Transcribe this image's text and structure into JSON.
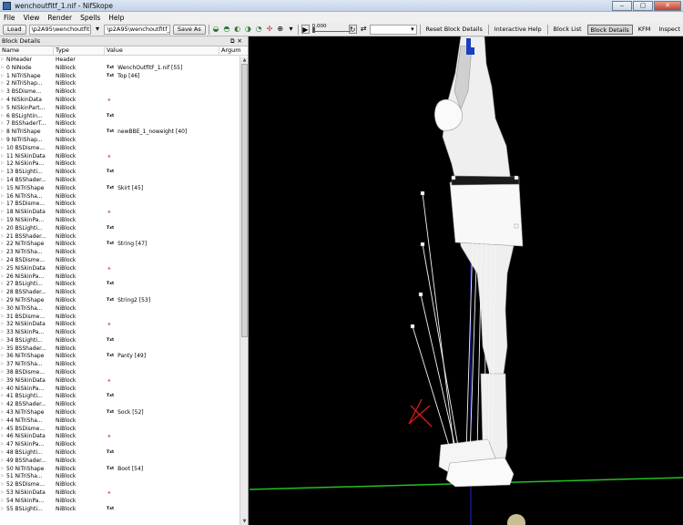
{
  "window": {
    "title": "wenchoutfitf_1.nif - NifSkope",
    "min": "‒",
    "max": "▢",
    "close": "✕"
  },
  "menu": [
    "File",
    "View",
    "Render",
    "Spells",
    "Help"
  ],
  "toolbar": {
    "load": "Load",
    "path_load": "\\p2A95\\wenchoutfitf_1.nif",
    "path_save": "\\p2A95\\wenchoutfitf_1.nif",
    "save_as": "Save As",
    "slider_value": "0.000",
    "reset": "Reset Block Details",
    "help": "Interactive Help",
    "block_list": "Block List",
    "block_details": "Block Details",
    "kfm": "KFM",
    "inspect": "Inspect"
  },
  "panel": {
    "title": "Block Details",
    "columns": [
      "Name",
      "Type",
      "Value",
      "Argum"
    ],
    "rows": [
      {
        "name": "NiHeader",
        "type": "Header",
        "value": "",
        "badge": ""
      },
      {
        "name": "0 NiNode",
        "type": "NiBlock",
        "value": "WenchOutfitF_1.nif [55]",
        "badge": "Txt"
      },
      {
        "name": "1 NiTriShape",
        "type": "NiBlock",
        "value": "Top [46]",
        "badge": "Txt"
      },
      {
        "name": "2 NiTriShap...",
        "type": "NiBlock",
        "value": "",
        "badge": ""
      },
      {
        "name": "3 BSDisme...",
        "type": "NiBlock",
        "value": "",
        "badge": ""
      },
      {
        "name": "4 NiSkinData",
        "type": "NiBlock",
        "value": "",
        "badge": "skin"
      },
      {
        "name": "5 NiSkinPart...",
        "type": "NiBlock",
        "value": "",
        "badge": ""
      },
      {
        "name": "6 BSLightin...",
        "type": "NiBlock",
        "value": "",
        "badge": "Txt"
      },
      {
        "name": "7 BSShaderT...",
        "type": "NiBlock",
        "value": "",
        "badge": ""
      },
      {
        "name": "8 NiTriShape",
        "type": "NiBlock",
        "value": "newBBE_1_noweight [40]",
        "badge": "Txt"
      },
      {
        "name": "9 NiTriShap...",
        "type": "NiBlock",
        "value": "",
        "badge": ""
      },
      {
        "name": "10 BSDisme...",
        "type": "NiBlock",
        "value": "",
        "badge": ""
      },
      {
        "name": "11 NiSkinData",
        "type": "NiBlock",
        "value": "",
        "badge": "skin"
      },
      {
        "name": "12 NiSkinPa...",
        "type": "NiBlock",
        "value": "",
        "badge": ""
      },
      {
        "name": "13 BSLighti...",
        "type": "NiBlock",
        "value": "",
        "badge": "Txt"
      },
      {
        "name": "14 BSShader...",
        "type": "NiBlock",
        "value": "",
        "badge": ""
      },
      {
        "name": "15 NiTriShape",
        "type": "NiBlock",
        "value": "Skirt [45]",
        "badge": "Txt"
      },
      {
        "name": "16 NiTriSha...",
        "type": "NiBlock",
        "value": "",
        "badge": ""
      },
      {
        "name": "17 BSDisme...",
        "type": "NiBlock",
        "value": "",
        "badge": ""
      },
      {
        "name": "18 NiSkinData",
        "type": "NiBlock",
        "value": "",
        "badge": "skin"
      },
      {
        "name": "19 NiSkinPa...",
        "type": "NiBlock",
        "value": "",
        "badge": ""
      },
      {
        "name": "20 BSLighti...",
        "type": "NiBlock",
        "value": "",
        "badge": "Txt"
      },
      {
        "name": "21 BSShader...",
        "type": "NiBlock",
        "value": "",
        "badge": ""
      },
      {
        "name": "22 NiTriShape",
        "type": "NiBlock",
        "value": "String [47]",
        "badge": "Txt"
      },
      {
        "name": "23 NiTriSha...",
        "type": "NiBlock",
        "value": "",
        "badge": ""
      },
      {
        "name": "24 BSDisme...",
        "type": "NiBlock",
        "value": "",
        "badge": ""
      },
      {
        "name": "25 NiSkinData",
        "type": "NiBlock",
        "value": "",
        "badge": "skin"
      },
      {
        "name": "26 NiSkinPa...",
        "type": "NiBlock",
        "value": "",
        "badge": ""
      },
      {
        "name": "27 BSLighti...",
        "type": "NiBlock",
        "value": "",
        "badge": "Txt"
      },
      {
        "name": "28 BSShader...",
        "type": "NiBlock",
        "value": "",
        "badge": ""
      },
      {
        "name": "29 NiTriShape",
        "type": "NiBlock",
        "value": "String2 [53]",
        "badge": "Txt"
      },
      {
        "name": "30 NiTriSha...",
        "type": "NiBlock",
        "value": "",
        "badge": ""
      },
      {
        "name": "31 BSDisme...",
        "type": "NiBlock",
        "value": "",
        "badge": ""
      },
      {
        "name": "32 NiSkinData",
        "type": "NiBlock",
        "value": "",
        "badge": "skin"
      },
      {
        "name": "33 NiSkinPa...",
        "type": "NiBlock",
        "value": "",
        "badge": ""
      },
      {
        "name": "34 BSLighti...",
        "type": "NiBlock",
        "value": "",
        "badge": "Txt"
      },
      {
        "name": "35 BSShader...",
        "type": "NiBlock",
        "value": "",
        "badge": ""
      },
      {
        "name": "36 NiTriShape",
        "type": "NiBlock",
        "value": "Panty [49]",
        "badge": "Txt"
      },
      {
        "name": "37 NiTriSha...",
        "type": "NiBlock",
        "value": "",
        "badge": ""
      },
      {
        "name": "38 BSDisme...",
        "type": "NiBlock",
        "value": "",
        "badge": ""
      },
      {
        "name": "39 NiSkinData",
        "type": "NiBlock",
        "value": "",
        "badge": "skin"
      },
      {
        "name": "40 NiSkinPa...",
        "type": "NiBlock",
        "value": "",
        "badge": ""
      },
      {
        "name": "41 BSLighti...",
        "type": "NiBlock",
        "value": "",
        "badge": "Txt"
      },
      {
        "name": "42 BSShader...",
        "type": "NiBlock",
        "value": "",
        "badge": ""
      },
      {
        "name": "43 NiTriShape",
        "type": "NiBlock",
        "value": "Sock [52]",
        "badge": "Txt"
      },
      {
        "name": "44 NiTriSha...",
        "type": "NiBlock",
        "value": "",
        "badge": ""
      },
      {
        "name": "45 BSDisme...",
        "type": "NiBlock",
        "value": "",
        "badge": ""
      },
      {
        "name": "46 NiSkinData",
        "type": "NiBlock",
        "value": "",
        "badge": "skin"
      },
      {
        "name": "47 NiSkinPa...",
        "type": "NiBlock",
        "value": "",
        "badge": ""
      },
      {
        "name": "48 BSLighti...",
        "type": "NiBlock",
        "value": "",
        "badge": "Txt"
      },
      {
        "name": "49 BSShader...",
        "type": "NiBlock",
        "value": "",
        "badge": ""
      },
      {
        "name": "50 NiTriShape",
        "type": "NiBlock",
        "value": "Boot [54]",
        "badge": "Txt"
      },
      {
        "name": "51 NiTriSha...",
        "type": "NiBlock",
        "value": "",
        "badge": ""
      },
      {
        "name": "52 BSDisme...",
        "type": "NiBlock",
        "value": "",
        "badge": ""
      },
      {
        "name": "53 NiSkinData",
        "type": "NiBlock",
        "value": "",
        "badge": "skin"
      },
      {
        "name": "54 NiSkinPa...",
        "type": "NiBlock",
        "value": "",
        "badge": ""
      },
      {
        "name": "55 BSLighti...",
        "type": "NiBlock",
        "value": "",
        "badge": "Txt"
      }
    ]
  },
  "colors": {
    "ground_line": "#22c022",
    "axis_x": "#e01818",
    "axis_y": "#2020d0",
    "model": "#f0f0f0"
  }
}
